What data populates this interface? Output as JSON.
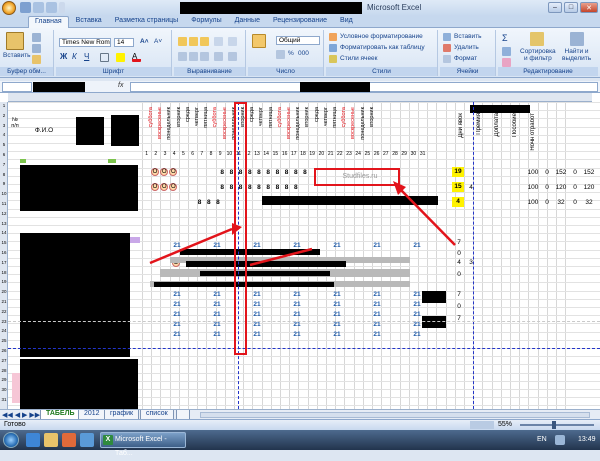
{
  "window": {
    "title": "Microsoft Excel"
  },
  "tabs": [
    "Главная",
    "Вставка",
    "Разметка страницы",
    "Формулы",
    "Данные",
    "Рецензирование",
    "Вид"
  ],
  "ribbon": {
    "clipboard": {
      "paste_label": "Вставить",
      "group_label": "Буфер обм..."
    },
    "font": {
      "font_name": "Times New Rom",
      "font_size": "14",
      "group_label": "Шрифт"
    },
    "alignment": {
      "group_label": "Выравнивание"
    },
    "number": {
      "format_value": "Общий",
      "group_label": "Число"
    },
    "styles": {
      "cond_format": "Условное форматирование",
      "format_table": "Форматировать как таблицу",
      "cell_styles": "Стили ячеек",
      "group_label": "Стили"
    },
    "cells": {
      "insert": "Вставить",
      "delete": "Удалить",
      "format": "Формат",
      "group_label": "Ячейки"
    },
    "editing": {
      "sort_filter": "Сортировка\nи фильтр",
      "find_select": "Найти и\nвыделить",
      "group_label": "Редактирование"
    }
  },
  "formula_bar": {
    "fx": "fx"
  },
  "sheet": {
    "fio_label": "Ф.И.О",
    "header_rotated": [
      "суббота",
      "воскресенье",
      "понедельник",
      "вторник",
      "среда",
      "четверг",
      "пятница",
      "суббота",
      "воскресенье",
      "понедельник",
      "вторник",
      "среда",
      "четверг",
      "пятница",
      "суббота",
      "воскресенье",
      "понедельник",
      "вторник",
      "среда",
      "четверг",
      "пятница",
      "суббота",
      "воскресенье",
      "понедельник",
      "вторник"
    ],
    "right_headers": [
      "Дни явок",
      "Премия",
      "Доплата",
      "Пособие",
      "Ночн отработ"
    ],
    "row_nums": [
      "1",
      "2",
      "3",
      "4",
      "5",
      "6",
      "7",
      "8",
      "9",
      "10",
      "11",
      "12",
      "13",
      "14",
      "15",
      "16",
      "17",
      "18",
      "19",
      "20",
      "21",
      "22",
      "23",
      "24",
      "25",
      "26",
      "27",
      "28",
      "29",
      "30",
      "31"
    ],
    "rows": [
      {
        "vals": [
          "О",
          "О",
          "О",
          "8",
          "8",
          "8",
          "8",
          "8",
          "8",
          "8",
          "8",
          "8",
          "8"
        ],
        "total": "19",
        "extra": [
          "100",
          "0",
          "152",
          "0",
          "152"
        ]
      },
      {
        "vals": [
          "О",
          "О",
          "О",
          "8",
          "8",
          "8",
          "8",
          "8",
          "8",
          "8",
          "8",
          "8"
        ],
        "total": "15",
        "extra": [
          "100",
          "0",
          "120",
          "0",
          "120"
        ]
      },
      {
        "vals": [
          "8",
          "8",
          "8",
          "8"
        ],
        "total": "4",
        "extra": [
          "100",
          "0",
          "32",
          "0",
          "32"
        ]
      }
    ],
    "code_21": "21",
    "right_counts": [
      "7",
      "0",
      "4",
      "3",
      "0",
      "7",
      "0",
      "7"
    ],
    "watermark": "Studfiles.ru"
  },
  "sheet_tabs": [
    "ТАБЕЛЬ",
    "2012",
    "график",
    "список"
  ],
  "status": {
    "ready": "Готово",
    "zoom": "55%"
  },
  "taskbar": {
    "excel_btn": "Microsoft Excel - Таб...",
    "lang": "EN",
    "clock": "13:49"
  }
}
